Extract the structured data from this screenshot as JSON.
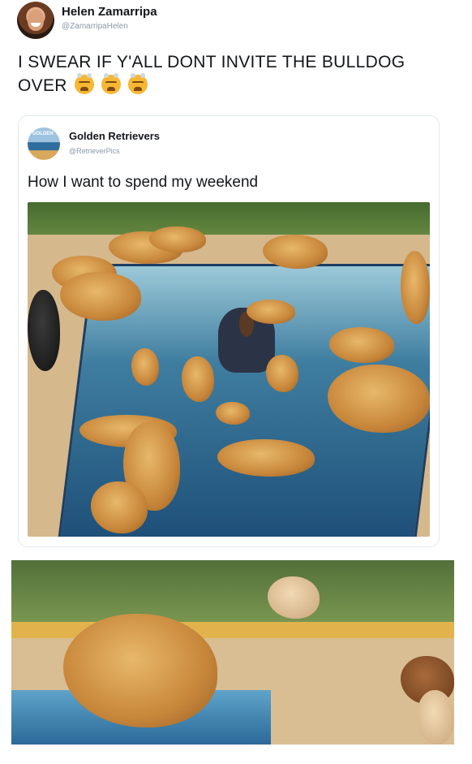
{
  "tweet": {
    "author_name": "Helen Zamarripa",
    "author_handle": "@ZamarripaHelen",
    "text": "I SWEAR IF Y'ALL DONT INVITE THE BULLDOG OVER",
    "emoji": [
      "steaming-angry-face",
      "steaming-angry-face",
      "steaming-angry-face"
    ]
  },
  "quoted_tweet": {
    "author_name": "Golden Retrievers",
    "author_handle": "@RetrieverPics",
    "avatar_label": "GOLDEN",
    "text": "How I want to spend my weekend"
  },
  "colors": {
    "text": "#14171a",
    "secondary": "#8899a6",
    "border": "#e1e8ed"
  }
}
